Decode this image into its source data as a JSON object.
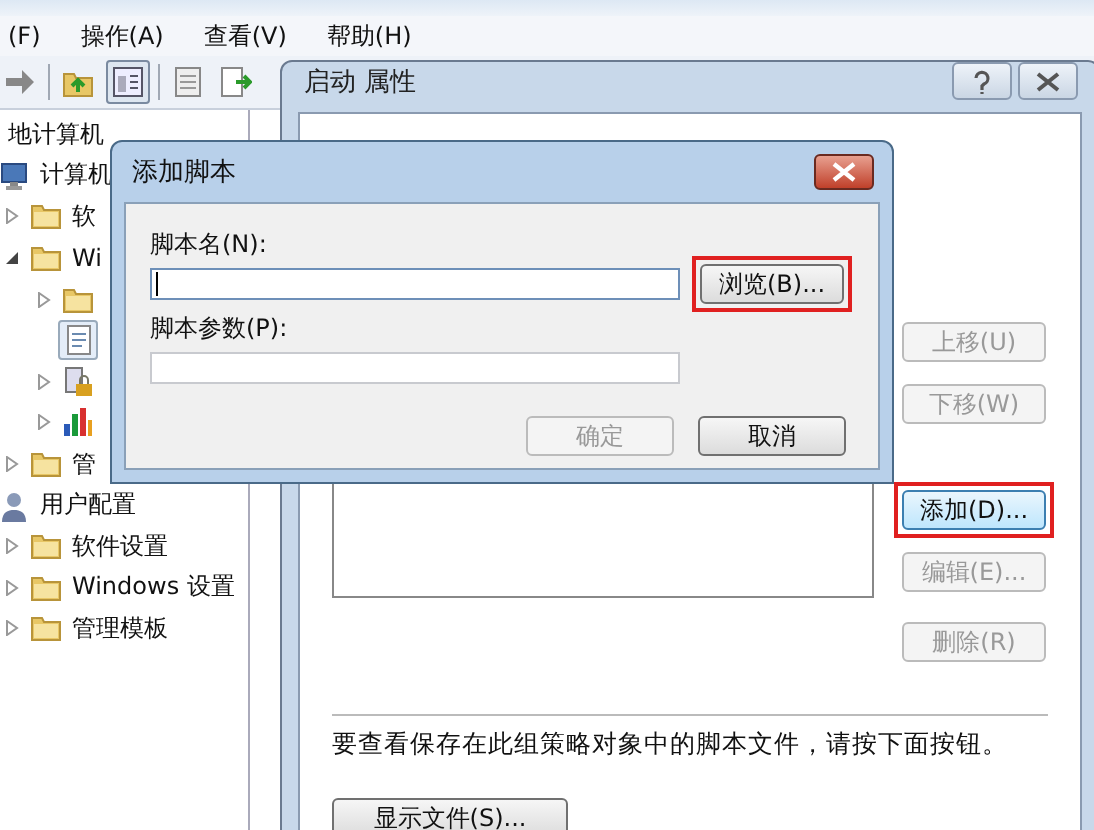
{
  "menu_bar": [
    {
      "label": "(F)"
    },
    {
      "label": "操作(A)"
    },
    {
      "label": "查看(V)"
    },
    {
      "label": "帮助(H)"
    }
  ],
  "tree": [
    {
      "label": "地计算机",
      "selected": false,
      "children": [
        {
          "label": "计算机",
          "kind": "computer",
          "selected": false,
          "children": [
            {
              "label": "软",
              "kind": "folder",
              "expanded": false,
              "selected": false
            },
            {
              "label": "Wi",
              "kind": "folder",
              "expanded": true,
              "selected": false,
              "children": [
                {
                  "kind": "folder",
                  "expanded": false,
                  "selected": false
                },
                {
                  "kind": "script",
                  "selected": true
                },
                {
                  "kind": "lock",
                  "expanded": false,
                  "selected": false
                },
                {
                  "kind": "chart",
                  "expanded": false,
                  "selected": false
                }
              ]
            },
            {
              "label": "管",
              "kind": "folder",
              "expanded": false,
              "selected": false
            }
          ]
        },
        {
          "label": "用户配置",
          "kind": "user",
          "selected": false,
          "children": [
            {
              "label": "软件设置",
              "kind": "folder",
              "expanded": false,
              "selected": false
            },
            {
              "label": "Windows 设置",
              "kind": "folder",
              "expanded": false,
              "selected": false
            },
            {
              "label": "管理模板",
              "kind": "folder",
              "expanded": false,
              "selected": false
            }
          ]
        }
      ]
    }
  ],
  "properties_window": {
    "title": "启动 属性",
    "side_buttons": [
      {
        "label": "上移(U)",
        "disabled": true,
        "highlighted": false
      },
      {
        "label": "下移(W)",
        "disabled": true,
        "highlighted": false
      },
      {
        "label": "添加(D)...",
        "disabled": false,
        "highlighted": true
      },
      {
        "label": "编辑(E)...",
        "disabled": true,
        "highlighted": false
      },
      {
        "label": "删除(R)",
        "disabled": true,
        "highlighted": false
      }
    ],
    "note": "要查看保存在此组策略对象中的脚本文件，请按下面按钮。",
    "show_files_button": "显示文件(S)..."
  },
  "dialog": {
    "title": "添加脚本",
    "fields": [
      {
        "label": "脚本名(N):",
        "focused": true
      },
      {
        "label": "脚本参数(P):",
        "focused": false
      }
    ],
    "browse_button": {
      "label": "浏览(B)...",
      "highlighted": true
    },
    "ok_button": {
      "label": "确定",
      "disabled": true
    },
    "cancel_button": {
      "label": "取消",
      "disabled": false
    }
  }
}
